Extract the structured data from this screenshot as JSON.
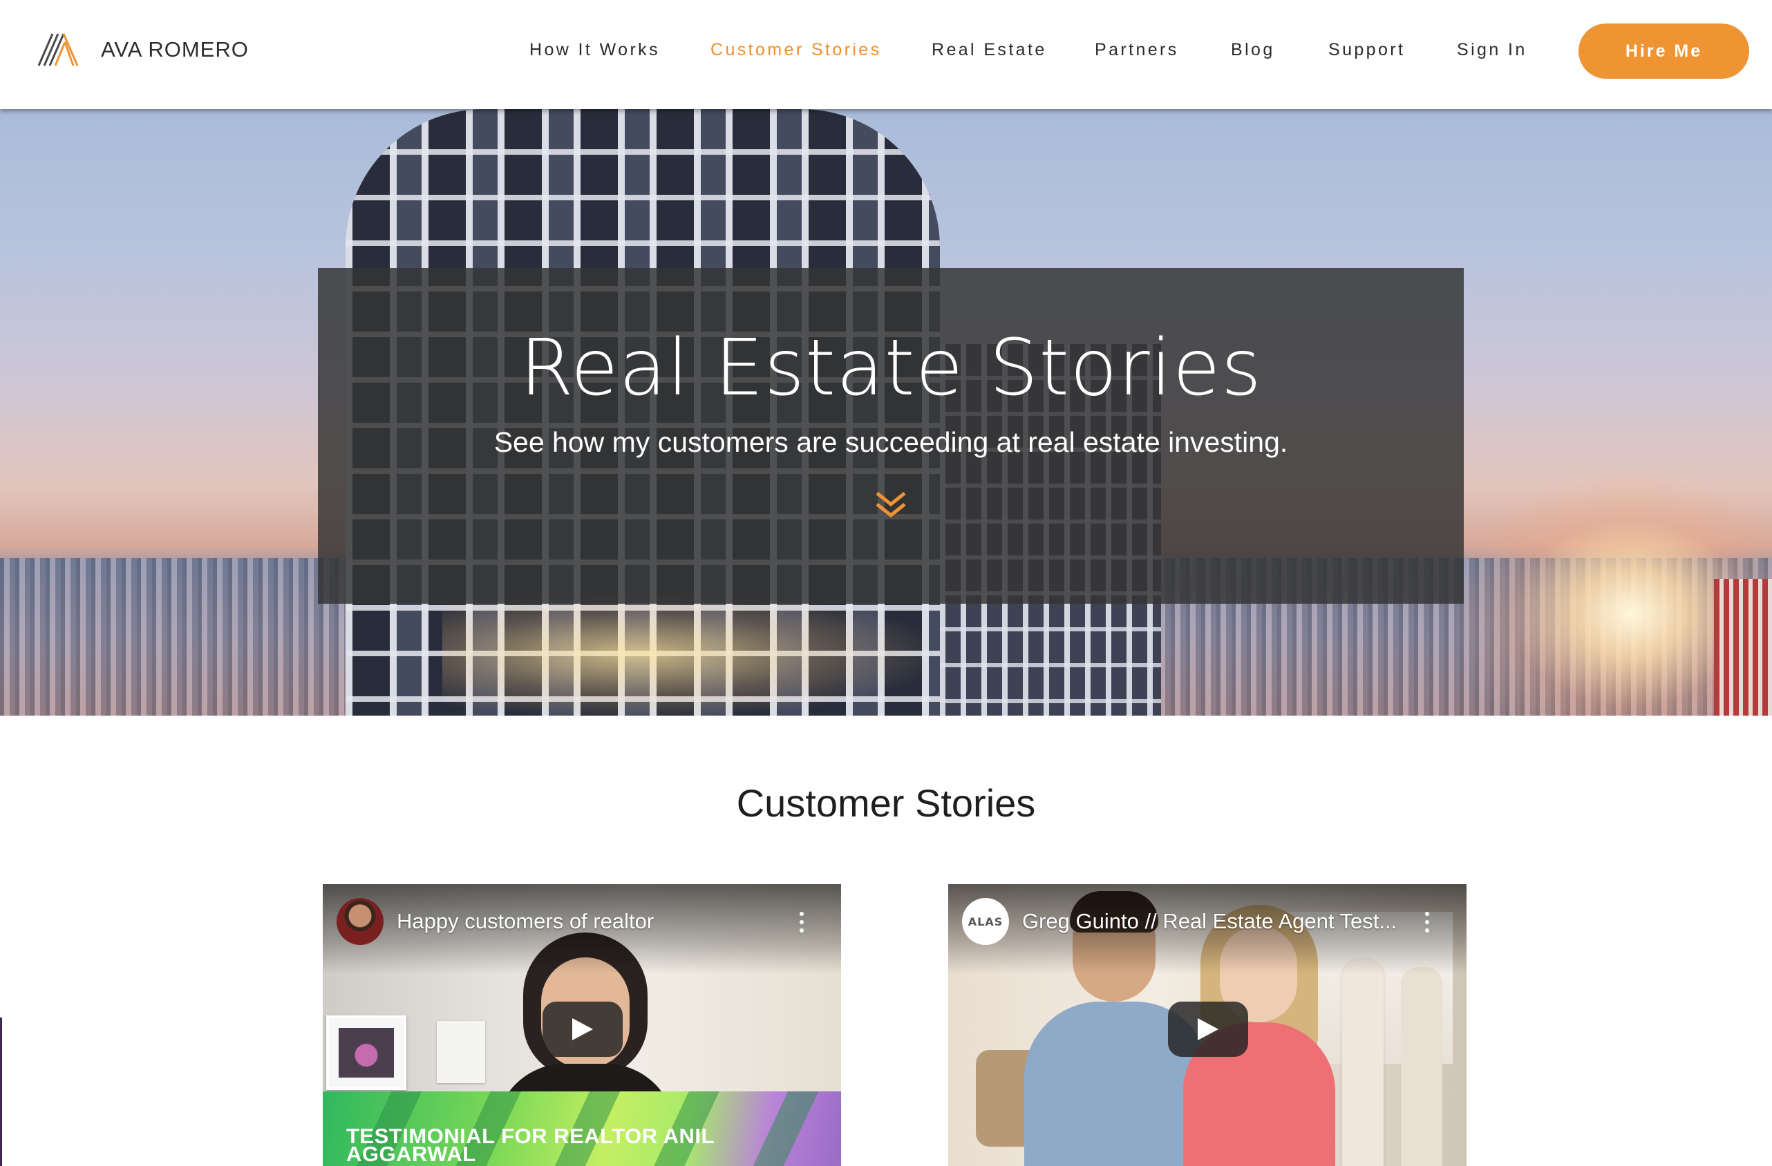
{
  "header": {
    "brand": "AVA ROMERO",
    "nav": [
      {
        "label": "How It Works",
        "active": false
      },
      {
        "label": "Customer Stories",
        "active": true
      },
      {
        "label": "Real Estate",
        "active": false
      },
      {
        "label": "Partners",
        "active": false
      },
      {
        "label": "Blog",
        "active": false
      },
      {
        "label": "Support",
        "active": false
      },
      {
        "label": "Sign In",
        "active": false
      }
    ],
    "cta_label": "Hire Me"
  },
  "hero": {
    "title": "Real Estate Stories",
    "subtitle": "See how my customers are succeeding at real estate investing.",
    "scroll_icon": "double-chevron-down-icon"
  },
  "stories": {
    "heading": "Customer Stories",
    "videos": [
      {
        "title": "Happy customers of realtor",
        "caption": "TESTIMONIAL FOR REALTOR ANIL AGGARWAL",
        "channel_avatar": "channel-avatar",
        "play_icon": "play-icon",
        "menu_icon": "more-vert-icon"
      },
      {
        "title": "Greg Guinto // Real Estate Agent Test...",
        "channel_logo_text": "ALAS",
        "play_icon": "play-icon",
        "menu_icon": "more-vert-icon"
      }
    ]
  },
  "colors": {
    "accent": "#ef9433",
    "nav_active": "#ee8f2c",
    "nav_text": "#2b2b2b",
    "hero_panel": "rgba(52,52,52,0.84)"
  }
}
